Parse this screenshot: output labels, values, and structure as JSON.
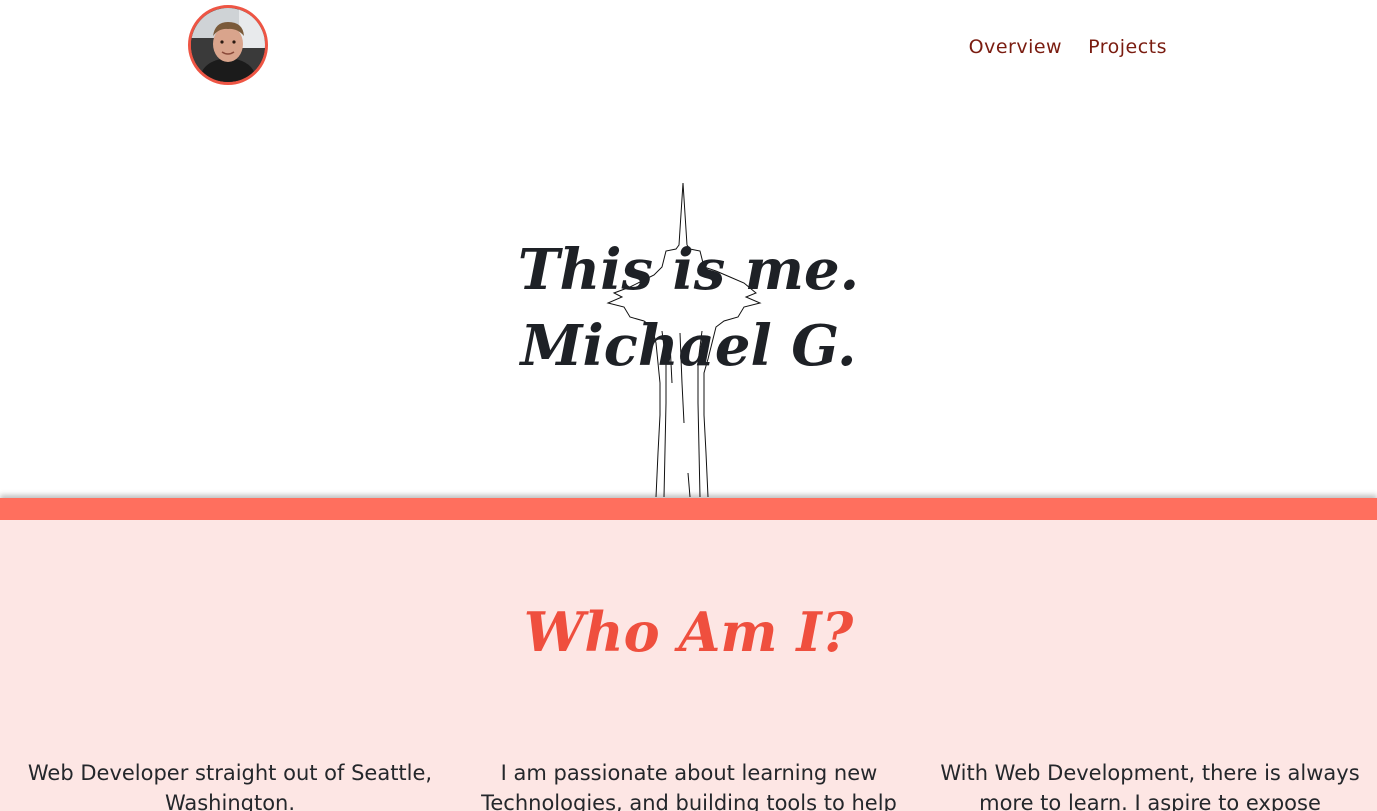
{
  "header": {
    "avatar_alt": "Profile photo",
    "nav": [
      {
        "label": "Overview"
      },
      {
        "label": "Projects"
      }
    ]
  },
  "hero": {
    "line1": "This is me.",
    "line2": "Michael G."
  },
  "about": {
    "title": "Who Am I?",
    "columns": [
      {
        "text": "Web Developer straight out of Seattle, Washington."
      },
      {
        "text": "I am passionate about learning new Technologies, and building tools to help"
      },
      {
        "text": "With Web Development, there is always more to learn. I aspire to expose myself."
      }
    ]
  },
  "colors": {
    "accent": "#ef4f3e",
    "band": "#ff6f5e",
    "section_bg": "#fde6e4",
    "nav_text": "#7a1c10",
    "heading_dark": "#1e2126"
  }
}
